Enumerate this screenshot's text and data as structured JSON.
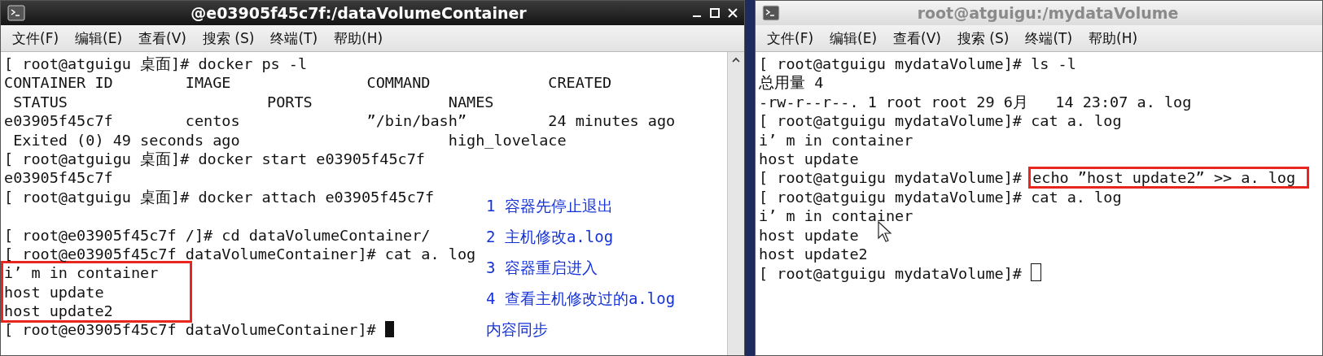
{
  "windows": [
    {
      "title": "@e03905f45c7f:/dataVolumeContainer",
      "focused": true,
      "scrollbar": true,
      "menu": [
        "文件(F)",
        "编辑(E)",
        "查看(V)",
        "搜索 (S)",
        "终端(T)",
        "帮助(H)"
      ],
      "lines": [
        {
          "kind": "line",
          "text": "[ root@atguigu 桌面]# docker ps -l"
        },
        {
          "kind": "line",
          "text": "CONTAINER ID        IMAGE               COMMAND             CREATED"
        },
        {
          "kind": "line",
          "text": " STATUS                      PORTS               NAMES"
        },
        {
          "kind": "line",
          "text": "e03905f45c7f        centos              ”/bin/bash”         24 minutes ago"
        },
        {
          "kind": "line",
          "text": " Exited (0) 49 seconds ago                       high_lovelace"
        },
        {
          "kind": "line",
          "text": "[ root@atguigu 桌面]# docker start e03905f45c7f"
        },
        {
          "kind": "line",
          "text": "e03905f45c7f"
        },
        {
          "kind": "line",
          "text": "[ root@atguigu 桌面]# docker attach e03905f45c7f"
        },
        {
          "kind": "blank"
        },
        {
          "kind": "line",
          "text": "[ root@e03905f45c7f /]# cd dataVolumeContainer/"
        },
        {
          "kind": "line",
          "text": "[ root@e03905f45c7f dataVolumeContainer]# cat a. log"
        },
        {
          "kind": "boxed",
          "lines": [
            "i’ m in container",
            "host update",
            "host update2"
          ]
        },
        {
          "kind": "line",
          "text": "[ root@e03905f45c7f dataVolumeContainer]# ",
          "cursor": true
        }
      ],
      "notes": [
        "1 容器先停止退出",
        "2 主机修改a.log",
        "3 容器重启进入",
        "4 查看主机修改过的a.log",
        "内容同步"
      ]
    },
    {
      "title": "root@atguigu:/mydataVolume",
      "focused": false,
      "scrollbar": false,
      "menu": [
        "文件(F)",
        "编辑(E)",
        "查看(V)",
        "搜索 (S)",
        "终端(T)",
        "帮助(H)"
      ],
      "lines": [
        {
          "kind": "line",
          "text": "[ root@atguigu mydataVolume]# ls -l"
        },
        {
          "kind": "line",
          "text": "总用量 4"
        },
        {
          "kind": "line",
          "text": "-rw-r--r--. 1 root root 29 6月   14 23:07 a. log"
        },
        {
          "kind": "line",
          "text": "[ root@atguigu mydataVolume]# cat a. log"
        },
        {
          "kind": "line",
          "text": "i’ m in container"
        },
        {
          "kind": "line",
          "text": "host update"
        },
        {
          "kind": "line",
          "text": "[ root@atguigu mydataVolume]# ",
          "marked": "echo ”host update2” >> a. log"
        },
        {
          "kind": "line",
          "text": "[ root@atguigu mydataVolume]# cat a. log"
        },
        {
          "kind": "line",
          "text": "i’ m in container"
        },
        {
          "kind": "line",
          "text": "host update"
        },
        {
          "kind": "line",
          "text": "host update2"
        },
        {
          "kind": "line",
          "text": "[ root@atguigu mydataVolume]# ",
          "cursor": true
        }
      ],
      "pointer": true
    }
  ]
}
